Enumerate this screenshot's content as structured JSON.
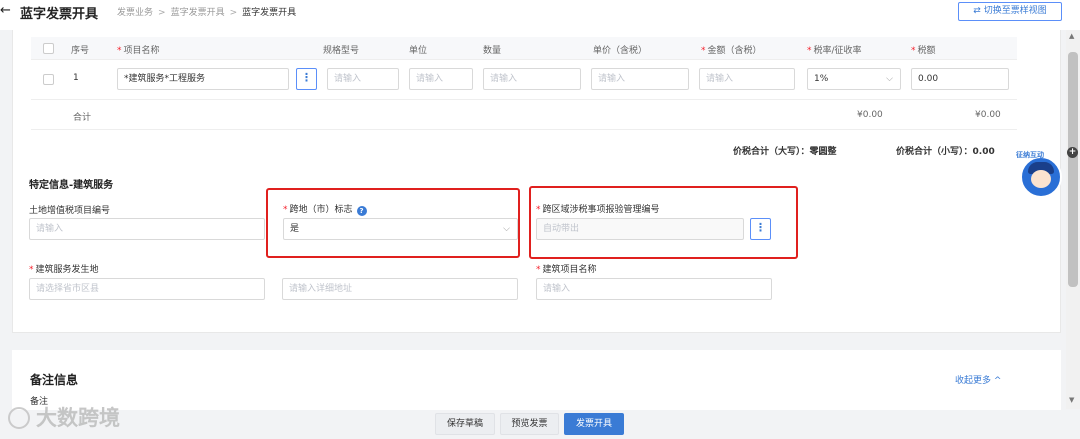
{
  "header": {
    "back_icon": "arrow-left-icon",
    "title": "蓝字发票开具",
    "breadcrumb": [
      "发票业务",
      "蓝字发票开具",
      "蓝字发票开具"
    ],
    "breadcrumb_sep": ">",
    "switch_view": "⇄ 切换至票样视图"
  },
  "table": {
    "columns": {
      "seq": "序号",
      "item_name": "项目名称",
      "spec": "规格型号",
      "unit": "单位",
      "qty": "数量",
      "unit_price": "单价（含税）",
      "amount": "金额（含税）",
      "tax_rate": "税率/征收率",
      "tax": "税额"
    },
    "required_mark": "*",
    "row": {
      "seq": "1",
      "item_name": "*建筑服务*工程服务",
      "more": "⋮",
      "spec_placeholder": "请输入",
      "unit_placeholder": "请输入",
      "qty_placeholder": "请输入",
      "unit_price_placeholder": "请输入",
      "amount_placeholder": "请输入",
      "tax_rate": "1%",
      "tax": "0.00"
    },
    "sum": {
      "label": "合计",
      "amount": "¥0.00",
      "tax": "¥0.00"
    }
  },
  "totals": {
    "upper_label": "价税合计（大写）：",
    "upper_value": "零圆整",
    "lower_label": "价税合计（小写）：",
    "lower_value": "0.00"
  },
  "special": {
    "title": "特定信息-建筑服务",
    "land_vat_label": "土地增值税项目编号",
    "land_vat_placeholder": "请输入",
    "cross_region_label": "跨地（市）标志",
    "help_icon": "?",
    "cross_region_value": "是",
    "cross_tax_label": "跨区域涉税事项报验管理编号",
    "cross_tax_placeholder": "自动带出",
    "more": "⋮",
    "location_label": "建筑服务发生地",
    "location_placeholder": "请选择省市区县",
    "address_placeholder": "请输入详细地址",
    "project_label": "建筑项目名称",
    "project_placeholder": "请输入",
    "required_mark": "*"
  },
  "remark": {
    "title": "备注信息",
    "collapse": "收起更多 ^",
    "sub": "备注"
  },
  "footer": {
    "save_draft": "保存草稿",
    "preview": "预览发票",
    "issue": "发票开具"
  },
  "watermark": {
    "text": "大数跨境"
  },
  "assistant": {
    "label": "征纳互动"
  },
  "scrollbar": {
    "up": "▲",
    "down": "▼",
    "plus": "+"
  },
  "colors": {
    "primary": "#3a7bd5",
    "highlight": "#e0201e",
    "required": "#f5222d"
  }
}
